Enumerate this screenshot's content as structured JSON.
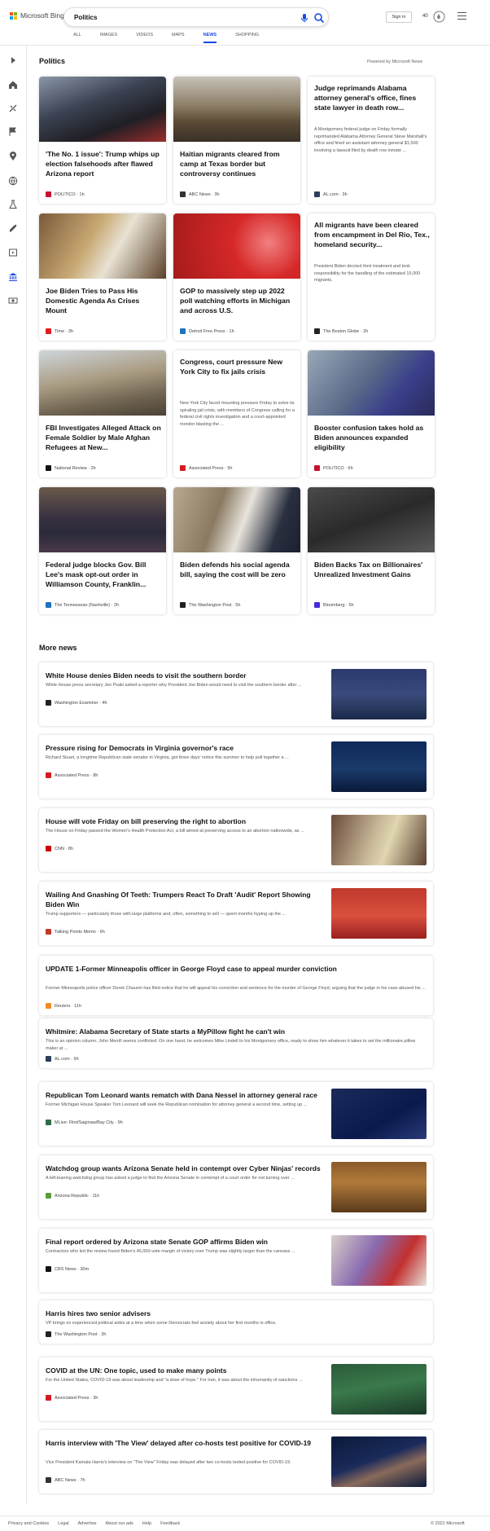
{
  "header": {
    "brand": "Microsoft Bing",
    "brand_colors": [
      "#f25022",
      "#7fba00",
      "#00a4ef",
      "#ffb900"
    ],
    "search_value": "Politics",
    "tabs": [
      "ALL",
      "IMAGES",
      "VIDEOS",
      "MAPS",
      "NEWS",
      "SHOPPING"
    ],
    "active_tab": "NEWS",
    "signin": "Sign in",
    "points": "40",
    "accent": "#174ae4"
  },
  "sidebar_icons": [
    "chevron-right-icon",
    "home-icon",
    "sports-icon",
    "flag-icon",
    "location-icon",
    "globe-icon",
    "science-icon",
    "rocket-icon",
    "entertainment-icon",
    "politics-icon",
    "money-icon"
  ],
  "section": {
    "title": "Politics",
    "powered": "Powered by Microsoft News"
  },
  "cards": [
    {
      "title": "'The No. 1 issue': Trump whips up election falsehoods after flawed Arizona report",
      "source": "POLITICO · 1h",
      "color": "#c8102e",
      "image": "rally"
    },
    {
      "title": "Haitian migrants cleared from camp at Texas border but controversy continues",
      "source": "ABC News · 3h",
      "color": "#333333",
      "image": "border"
    },
    {
      "title": "Judge reprimands Alabama attorney general's office, fines state lawyer in death row...",
      "snippet": "A Montgomery federal judge on Friday formally reprimanded Alabama Attorney General Steve Marshall's office and fined an assistant attorney general $1,500 involving a lawsuit filed by death row inmate ...",
      "source": "AL.com · 3h",
      "color": "#2b3e5a",
      "image": ""
    },
    {
      "title": "Joe Biden Tries to Pass His Domestic Agenda As Crises Mount",
      "source": "Time · 3h",
      "color": "#e31b23",
      "image": "office"
    },
    {
      "title": "GOP to massively step up 2022 poll watching efforts in Michigan and across U.S.",
      "source": "Detroit Free Press · 1h",
      "color": "#1e73be",
      "image": "stage"
    },
    {
      "title": "All migrants have been cleared from encampment in Del Rio, Tex., homeland security...",
      "snippet": "President Biden decried their treatment and took responsibility for the handling of the estimated 15,000 migrants.",
      "source": "The Boston Globe · 2h",
      "color": "#222222",
      "image": ""
    },
    {
      "title": "FBI Investigates Alleged Attack on Female Soldier by Male Afghan Refugees at New...",
      "source": "National Review · 2h",
      "color": "#111111",
      "image": "soldiers"
    },
    {
      "title": "Congress, court pressure New York City to fix jails crisis",
      "snippet": "New York City faced mounting pressure Friday to solve its spiraling jail crisis, with members of Congress calling for a federal civil rights investigation and a court-appointed monitor blasting the ...",
      "source": "Associated Press · 5h",
      "color": "#d71920",
      "image": ""
    },
    {
      "title": "Booster confusion takes hold as Biden announces expanded eligibility",
      "source": "POLITICO · 6h",
      "color": "#c8102e",
      "image": "vaccine"
    },
    {
      "title": "Federal judge blocks Gov. Bill Lee's mask opt-out order in Williamson County, Franklin...",
      "source": "The Tennessean (Nashville) · 2h",
      "color": "#1e73be",
      "image": "crowd"
    },
    {
      "title": "Biden defends his social agenda bill, saying the cost will be zero",
      "source": "The Washington Post · 5h",
      "color": "#222222",
      "image": "biden"
    },
    {
      "title": "Biden Backs Tax on Billionaires' Unrealized Investment Gains",
      "source": "Bloomberg · 5h",
      "color": "#4b2ad9",
      "image": "podium"
    }
  ],
  "more": {
    "title": "More news",
    "items": [
      {
        "title": "White House denies Biden needs to visit the southern border",
        "snippet": "White House press secretary Jen Psaki asked a reporter why President Joe Biden would need to visit the southern border after ...",
        "source": "Washington Examiner · 4h",
        "color": "#222222",
        "image": "briefing"
      },
      {
        "title": "Pressure rising for Democrats in Virginia governor's race",
        "snippet": "Richard Stuart, a longtime Republican state senator in Virginia, got three days' notice this summer to help pull together a ...",
        "source": "Associated Press · 8h",
        "color": "#d71920",
        "image": "debate"
      },
      {
        "title": "House will vote Friday on bill preserving the right to abortion",
        "snippet": "The House on Friday passed the Women's Health Protection Act, a bill aimed at preserving access to an abortion nationwide, as ...",
        "source": "CNN · 8h",
        "color": "#cc0000",
        "image": "capitol"
      },
      {
        "title": "Wailing And Gnashing Of Teeth: Trumpers React To Draft 'Audit' Report Showing Biden Win",
        "snippet": "Trump supporters — particularly those with large platforms and, often, something to sell — spent months hyping up the ...",
        "source": "Talking Points Memo · 6h",
        "color": "#c0392b",
        "image": "ward"
      },
      {
        "title": "UPDATE 1-Former Minneapolis officer in George Floyd case to appeal murder conviction",
        "snippet": "Former Minneapolis police officer Derek Chauvin has filed notice that he will appeal his conviction and sentence for the murder of George Floyd, arguing that the judge in his case abused his ...",
        "source": "Reuters · 11h",
        "color": "#f28c28",
        "image": ""
      },
      {
        "title": "Whitmire: Alabama Secretary of State starts a MyPillow fight he can't win",
        "snippet": "This is an opinion column. John Merrill seems conflicted. On one hand, he welcomes Mike Lindell to his Montgomery office, ready to show him whatever it takes to set the millionaire pillow maker at ...",
        "source": "AL.com · 9h",
        "color": "#2b3e5a",
        "image": ""
      },
      {
        "title": "Republican Tom Leonard wants rematch with Dana Nessel in attorney general race",
        "snippet": "Former Michigan House Speaker Tom Leonard will seek the Republican nomination for attorney general a second time, setting up ...",
        "source": "MLive: Flint/Saginaw/Bay City · 9h",
        "color": "#2c6e49",
        "image": "speaker"
      },
      {
        "title": "Watchdog group wants Arizona Senate held in contempt over Cyber Ninjas' records",
        "snippet": "A left-leaning watchdog group has asked a judge to find the Arizona Senate in contempt of a court order for not turning over ...",
        "source": "Arizona Republic · 11h",
        "color": "#5a9e3a",
        "image": "senate"
      },
      {
        "title": "Final report ordered by Arizona state Senate GOP affirms Biden win",
        "snippet": "Contractors who led the review found Biden's 45,000-vote margin of victory over Trump was slightly larger than the canvass ...",
        "source": "CBS News · 30m",
        "color": "#111111",
        "image": "officials"
      },
      {
        "title": "Harris hires two senior advisers",
        "snippet": "VP brings on experienced political aides at a time when some Democrats feel anxiety about her first months in office.",
        "source": "The Washington Post · 3h",
        "color": "#222222",
        "image": ""
      },
      {
        "title": "COVID at the UN: One topic, used to make many points",
        "snippet": "For the United States, COVID-19 was about leadership and \"a dose of hope.\" For Iran, it was about the inhumanity of sanctions ...",
        "source": "Associated Press · 3h",
        "color": "#d71920",
        "image": "un"
      },
      {
        "title": "Harris interview with 'The View' delayed after co-hosts test positive for COVID-19",
        "snippet": "Vice President Kamala Harris's interview on \"The View\" Friday was delayed after two co-hosts tested positive for COVID-19.",
        "source": "ABC News · 7h",
        "color": "#333333",
        "image": "harris"
      }
    ]
  },
  "footer": {
    "links": [
      "Privacy and Cookies",
      "Legal",
      "Advertise",
      "About our ads",
      "Help",
      "Feedback"
    ],
    "copyright": "© 2021 Microsoft"
  }
}
